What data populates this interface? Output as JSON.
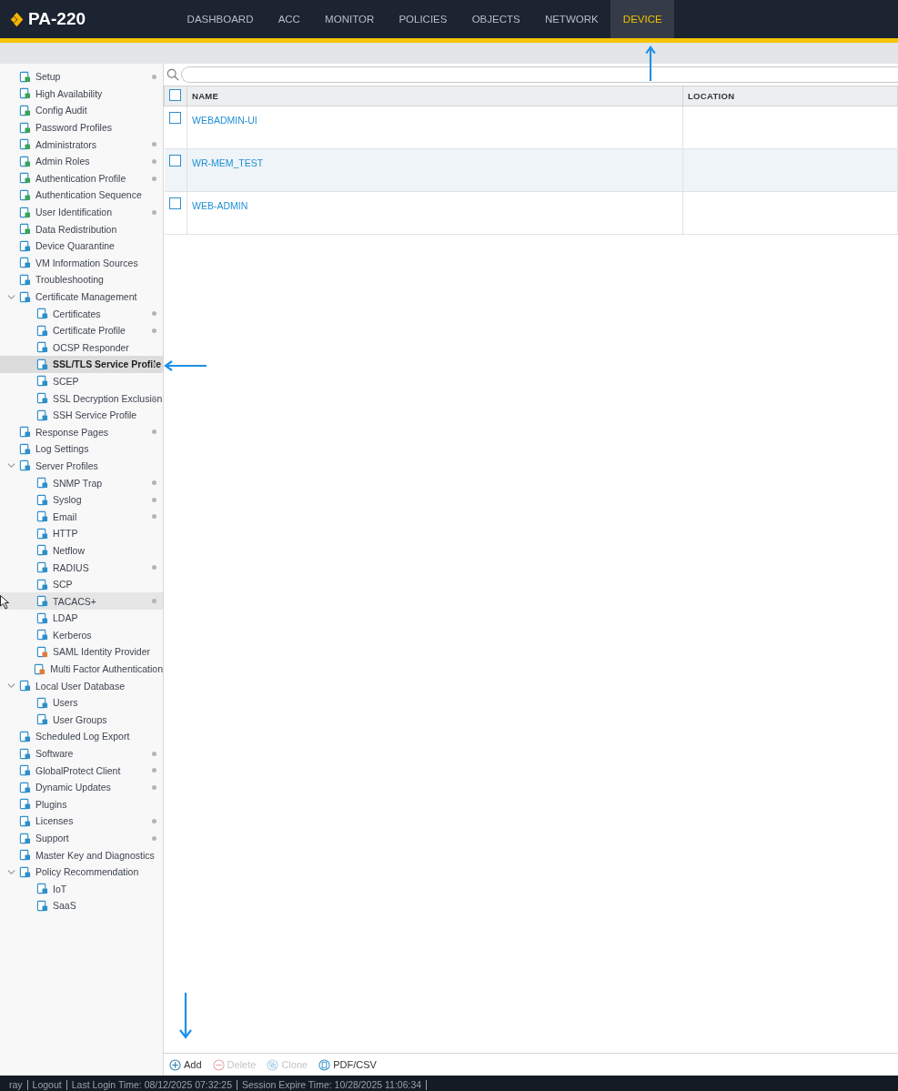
{
  "app": {
    "title": "PA-220"
  },
  "tabs": [
    {
      "label": "DASHBOARD",
      "selected": false
    },
    {
      "label": "ACC",
      "selected": false
    },
    {
      "label": "MONITOR",
      "selected": false
    },
    {
      "label": "POLICIES",
      "selected": false
    },
    {
      "label": "OBJECTS",
      "selected": false
    },
    {
      "label": "NETWORK",
      "selected": false
    },
    {
      "label": "DEVICE",
      "selected": true
    }
  ],
  "sidebar": {
    "items": [
      {
        "label": "Setup",
        "dot": true,
        "selected": false,
        "hovered": false
      },
      {
        "label": "High Availability",
        "dot": false,
        "selected": false,
        "hovered": false
      },
      {
        "label": "Config Audit",
        "dot": false,
        "selected": false,
        "hovered": false
      },
      {
        "label": "Password Profiles",
        "dot": false,
        "selected": false,
        "hovered": false
      },
      {
        "label": "Administrators",
        "dot": true,
        "selected": false,
        "hovered": false
      },
      {
        "label": "Admin Roles",
        "dot": true,
        "selected": false,
        "hovered": false
      },
      {
        "label": "Authentication Profile",
        "dot": true,
        "selected": false,
        "hovered": false
      },
      {
        "label": "Authentication Sequence",
        "dot": false,
        "selected": false,
        "hovered": false
      },
      {
        "label": "User Identification",
        "dot": true,
        "selected": false,
        "hovered": false
      },
      {
        "label": "Data Redistribution",
        "dot": false,
        "selected": false,
        "hovered": false
      },
      {
        "label": "Device Quarantine",
        "dot": false,
        "selected": false,
        "hovered": false
      },
      {
        "label": "VM Information Sources",
        "dot": false,
        "selected": false,
        "hovered": false
      },
      {
        "label": "Troubleshooting",
        "dot": false,
        "selected": false,
        "hovered": false
      },
      {
        "label": "Certificate Management",
        "dot": false,
        "selected": false,
        "hovered": false,
        "expanded": true,
        "children": [
          {
            "label": "Certificates",
            "dot": true,
            "selected": false,
            "hovered": false
          },
          {
            "label": "Certificate Profile",
            "dot": true,
            "selected": false,
            "hovered": false
          },
          {
            "label": "OCSP Responder",
            "dot": false,
            "selected": false,
            "hovered": false
          },
          {
            "label": "SSL/TLS Service Profile",
            "dot": true,
            "selected": true,
            "hovered": false
          },
          {
            "label": "SCEP",
            "dot": false,
            "selected": false,
            "hovered": false
          },
          {
            "label": "SSL Decryption Exclusion",
            "dot": true,
            "selected": false,
            "hovered": false
          },
          {
            "label": "SSH Service Profile",
            "dot": false,
            "selected": false,
            "hovered": false
          }
        ]
      },
      {
        "label": "Response Pages",
        "dot": true,
        "selected": false,
        "hovered": false
      },
      {
        "label": "Log Settings",
        "dot": false,
        "selected": false,
        "hovered": false
      },
      {
        "label": "Server Profiles",
        "dot": false,
        "selected": false,
        "hovered": false,
        "expanded": true,
        "children": [
          {
            "label": "SNMP Trap",
            "dot": true,
            "selected": false,
            "hovered": false
          },
          {
            "label": "Syslog",
            "dot": true,
            "selected": false,
            "hovered": false
          },
          {
            "label": "Email",
            "dot": true,
            "selected": false,
            "hovered": false
          },
          {
            "label": "HTTP",
            "dot": false,
            "selected": false,
            "hovered": false
          },
          {
            "label": "Netflow",
            "dot": false,
            "selected": false,
            "hovered": false
          },
          {
            "label": "RADIUS",
            "dot": true,
            "selected": false,
            "hovered": false
          },
          {
            "label": "SCP",
            "dot": false,
            "selected": false,
            "hovered": false
          },
          {
            "label": "TACACS+",
            "dot": true,
            "selected": false,
            "hovered": true
          },
          {
            "label": "LDAP",
            "dot": false,
            "selected": false,
            "hovered": false
          },
          {
            "label": "Kerberos",
            "dot": false,
            "selected": false,
            "hovered": false
          },
          {
            "label": "SAML Identity Provider",
            "dot": false,
            "selected": false,
            "hovered": false
          },
          {
            "label": "Multi Factor Authentication",
            "dot": false,
            "selected": false,
            "hovered": false
          }
        ]
      },
      {
        "label": "Local User Database",
        "dot": false,
        "selected": false,
        "hovered": false,
        "expanded": true,
        "children": [
          {
            "label": "Users",
            "dot": false,
            "selected": false,
            "hovered": false
          },
          {
            "label": "User Groups",
            "dot": false,
            "selected": false,
            "hovered": false
          }
        ]
      },
      {
        "label": "Scheduled Log Export",
        "dot": false,
        "selected": false,
        "hovered": false
      },
      {
        "label": "Software",
        "dot": true,
        "selected": false,
        "hovered": false
      },
      {
        "label": "GlobalProtect Client",
        "dot": true,
        "selected": false,
        "hovered": false
      },
      {
        "label": "Dynamic Updates",
        "dot": true,
        "selected": false,
        "hovered": false
      },
      {
        "label": "Plugins",
        "dot": false,
        "selected": false,
        "hovered": false
      },
      {
        "label": "Licenses",
        "dot": true,
        "selected": false,
        "hovered": false
      },
      {
        "label": "Support",
        "dot": true,
        "selected": false,
        "hovered": false
      },
      {
        "label": "Master Key and Diagnostics",
        "dot": false,
        "selected": false,
        "hovered": false
      },
      {
        "label": "Policy Recommendation",
        "dot": false,
        "selected": false,
        "hovered": false,
        "expanded": true,
        "children": [
          {
            "label": "IoT",
            "dot": false,
            "selected": false,
            "hovered": false
          },
          {
            "label": "SaaS",
            "dot": false,
            "selected": false,
            "hovered": false
          }
        ]
      }
    ]
  },
  "table": {
    "columns": [
      "NAME",
      "LOCATION"
    ],
    "all_checked": false,
    "rows": [
      {
        "name": "WEBADMIN-UI",
        "checked": false
      },
      {
        "name": "WR-MEM_TEST",
        "checked": false
      },
      {
        "name": "WEB-ADMIN",
        "checked": false
      }
    ]
  },
  "toolbar": [
    {
      "kind": "add",
      "label": "Add",
      "disabled": false
    },
    {
      "kind": "delete",
      "label": "Delete",
      "disabled": true
    },
    {
      "kind": "clone",
      "label": "Clone",
      "disabled": true
    },
    {
      "kind": "pdf",
      "label": "PDF/CSV",
      "disabled": false
    }
  ],
  "status_bar": [
    "ray",
    "Logout",
    "Last Login Time: 08/12/2025 07:32:25",
    "Session Expire Time: 10/28/2025 11:06:34"
  ]
}
